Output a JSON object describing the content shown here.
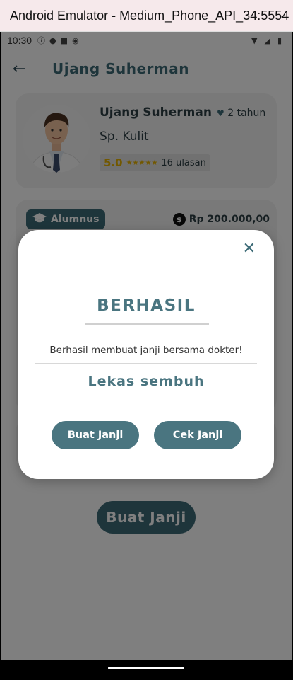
{
  "window": {
    "title": "Android Emulator - Medium_Phone_API_34:5554"
  },
  "status_bar": {
    "time": "10:30"
  },
  "app_bar": {
    "title": "Ujang Suherman"
  },
  "doctor": {
    "name": "Ujang Suherman",
    "experience": "2 tahun",
    "specialty": "Sp. Kulit",
    "rating": "5.0",
    "stars": "★★★★★",
    "reviews": "16 ulasan"
  },
  "info": {
    "badge": "Alumnus",
    "price": "Rp 200.000,00"
  },
  "primary_button": {
    "label": "Buat Janji"
  },
  "dialog": {
    "title": "BERHASIL",
    "message": "Berhasil membuat janji bersama dokter!",
    "wish": "Lekas sembuh",
    "button_left": "Buat Janji",
    "button_right": "Cek Janji"
  },
  "colors": {
    "primary": "#4a7580",
    "rating": "#e4b100"
  }
}
